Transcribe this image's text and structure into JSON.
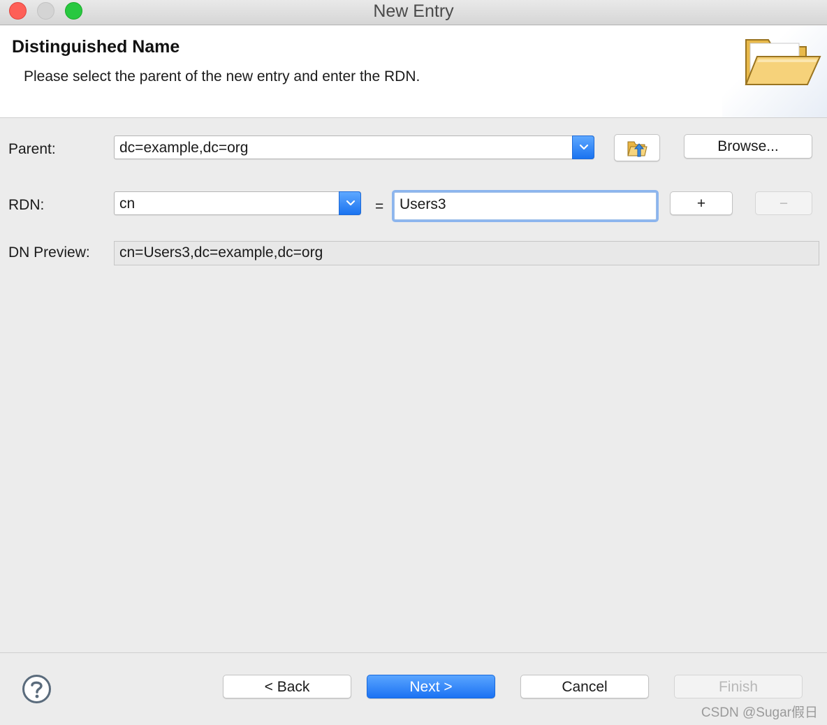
{
  "window": {
    "title": "New Entry",
    "buttons": [
      "close",
      "minimize",
      "zoom"
    ]
  },
  "header": {
    "title": "Distinguished Name",
    "description": "Please select the parent of the new entry and enter the RDN.",
    "icon": "folder-open-icon"
  },
  "form": {
    "parent": {
      "label": "Parent:",
      "value": "dc=example,dc=org",
      "up_button_icon": "parent-folder-up-icon",
      "browse_label": "Browse..."
    },
    "rdn": {
      "label": "RDN:",
      "attribute": "cn",
      "equals": "=",
      "value": "Users3",
      "add_label": "+",
      "remove_label": "−"
    },
    "dn_preview": {
      "label": "DN Preview:",
      "value": "cn=Users3,dc=example,dc=org"
    }
  },
  "footer": {
    "help_icon": "help-icon",
    "back_label": "< Back",
    "next_label": "Next >",
    "cancel_label": "Cancel",
    "finish_label": "Finish"
  },
  "watermark": "CSDN @Sugar假日",
  "colors": {
    "accent": "#1b72f3",
    "focus_ring": "#8cb5ee",
    "close": "#fe5f57",
    "zoom": "#28c840"
  }
}
